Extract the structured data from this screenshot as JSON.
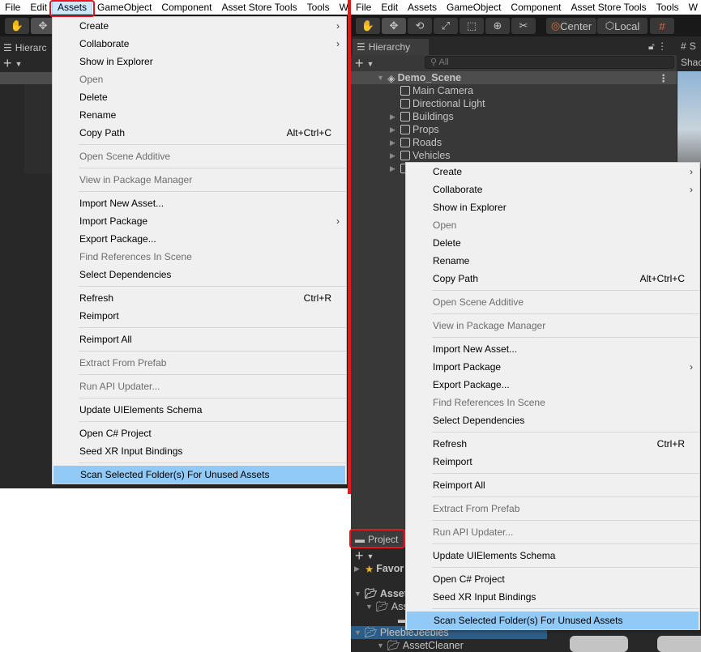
{
  "menubar": [
    "File",
    "Edit",
    "Assets",
    "GameObject",
    "Component",
    "Asset Store Tools",
    "Tools",
    "W"
  ],
  "toolbar": {
    "center": "Center",
    "local": "Local"
  },
  "hierarchy": {
    "tab": "Hierarchy",
    "search_placeholder": "All",
    "scene": "Demo_Scene",
    "items": [
      {
        "label": "Main Camera",
        "expandable": false
      },
      {
        "label": "Directional Light",
        "expandable": false
      },
      {
        "label": "Buildings",
        "expandable": true
      },
      {
        "label": "Props",
        "expandable": true
      },
      {
        "label": "Roads",
        "expandable": true
      },
      {
        "label": "Vehicles",
        "expandable": true
      }
    ]
  },
  "left_panel": {
    "hierarchy_tab_partial": "Hierarc"
  },
  "scene_view": {
    "tab_partial": "S",
    "shading_partial": "Shac"
  },
  "project": {
    "tab": "Project",
    "rows": [
      "Favor",
      "Asset",
      "Asse",
      "E",
      "PleebleJeebles",
      "AssetCleaner"
    ]
  },
  "assets_menu": [
    {
      "label": "Create",
      "submenu": true
    },
    {
      "label": "Collaborate",
      "submenu": true
    },
    {
      "label": "Show in Explorer"
    },
    {
      "label": "Open",
      "disabled": true
    },
    {
      "label": "Delete"
    },
    {
      "label": "Rename"
    },
    {
      "label": "Copy Path",
      "shortcut": "Alt+Ctrl+C"
    },
    {
      "sep": true
    },
    {
      "label": "Open Scene Additive",
      "disabled": true
    },
    {
      "sep": true
    },
    {
      "label": "View in Package Manager",
      "disabled": true
    },
    {
      "sep": true
    },
    {
      "label": "Import New Asset..."
    },
    {
      "label": "Import Package",
      "submenu": true
    },
    {
      "label": "Export Package..."
    },
    {
      "label": "Find References In Scene",
      "disabled": true
    },
    {
      "label": "Select Dependencies"
    },
    {
      "sep": true
    },
    {
      "label": "Refresh",
      "shortcut": "Ctrl+R"
    },
    {
      "label": "Reimport"
    },
    {
      "sep": true
    },
    {
      "label": "Reimport All"
    },
    {
      "sep": true
    },
    {
      "label": "Extract From Prefab",
      "disabled": true
    },
    {
      "sep": true
    },
    {
      "label": "Run API Updater...",
      "disabled": true
    },
    {
      "sep": true
    },
    {
      "label": "Update UIElements Schema"
    },
    {
      "sep": true
    },
    {
      "label": "Open C# Project"
    },
    {
      "label": "Seed XR Input Bindings"
    },
    {
      "sep": true
    },
    {
      "label": "Scan Selected Folder(s) For Unused Assets",
      "selected": true
    }
  ],
  "colors": {
    "highlight": "#91c9f7",
    "annotation": "#e8141e",
    "selection": "#2c5d87"
  }
}
